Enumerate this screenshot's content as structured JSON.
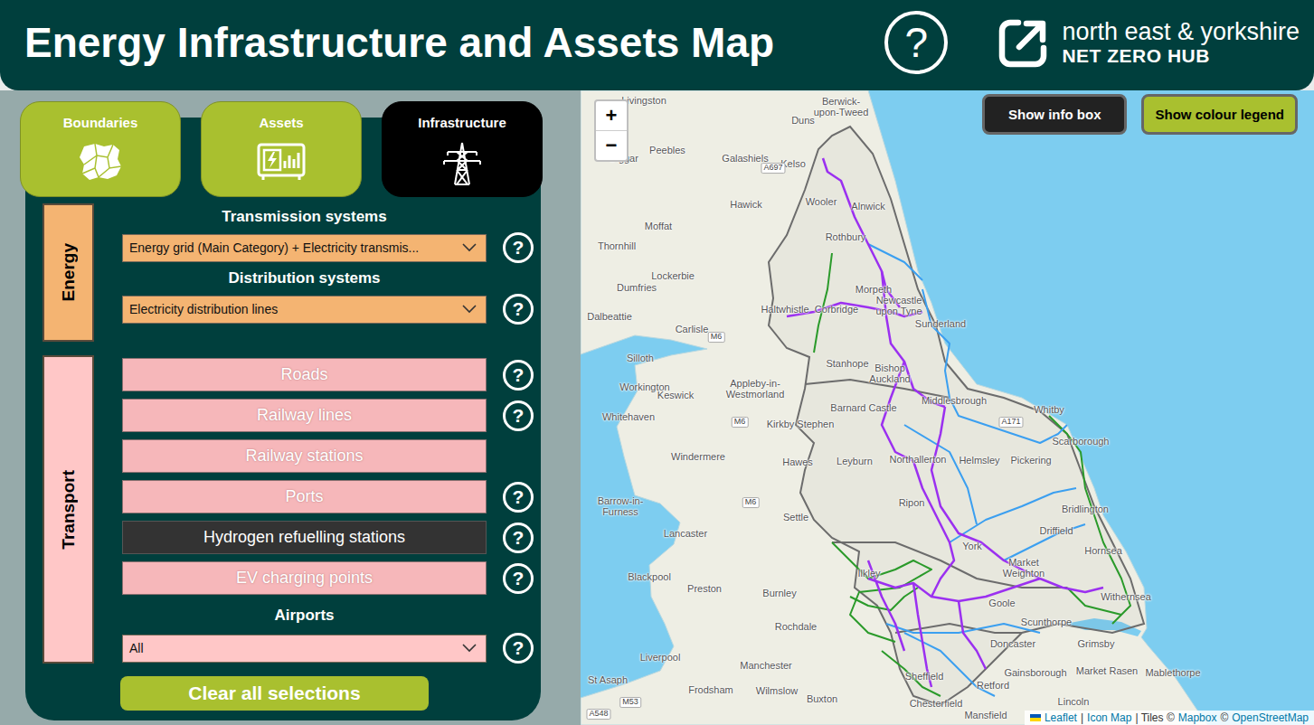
{
  "header": {
    "title": "Energy Infrastructure and Assets Map",
    "help_icon": "?",
    "logo_line1": "north east & yorkshire",
    "logo_line2": "NET ZERO HUB"
  },
  "tabs": [
    {
      "label": "Boundaries",
      "kind": "boundaries",
      "selected": false
    },
    {
      "label": "Assets",
      "kind": "assets",
      "selected": false
    },
    {
      "label": "Infrastructure",
      "kind": "infrastructure",
      "selected": true
    }
  ],
  "help_icon": "?",
  "energy": {
    "label": "Energy",
    "groups": [
      {
        "heading": "Transmission systems",
        "value": "Energy grid (Main Category) + Electricity transmis..."
      },
      {
        "heading": "Distribution systems",
        "value": "Electricity distribution lines"
      }
    ]
  },
  "transport": {
    "label": "Transport",
    "buttons": [
      {
        "label": "Roads",
        "selected": false,
        "help": true
      },
      {
        "label": "Railway lines",
        "selected": false,
        "help": true
      },
      {
        "label": "Railway stations",
        "selected": false,
        "help": false
      },
      {
        "label": "Ports",
        "selected": false,
        "help": true
      },
      {
        "label": "Hydrogen refuelling stations",
        "selected": true,
        "help": true
      },
      {
        "label": "EV charging points",
        "selected": false,
        "help": true
      }
    ],
    "airports": {
      "heading": "Airports",
      "value": "All"
    }
  },
  "clear_button": "Clear all selections",
  "map": {
    "zoom": [
      "+",
      "−"
    ],
    "buttons": [
      {
        "label": "Show info box",
        "kind": "dark"
      },
      {
        "label": "Show colour legend",
        "kind": "green"
      }
    ],
    "places": [
      {
        "name": "Livingston",
        "kind": "place"
      },
      {
        "name": "Berwick-upon-Tweed",
        "kind": "place"
      },
      {
        "name": "Duns",
        "kind": "place"
      },
      {
        "name": "Peebles",
        "kind": "place"
      },
      {
        "name": "Galashiels",
        "kind": "place"
      },
      {
        "name": "Kelso",
        "kind": "place"
      },
      {
        "name": "Biggar",
        "kind": "place"
      },
      {
        "name": "A697",
        "kind": "road"
      },
      {
        "name": "Wooler",
        "kind": "place"
      },
      {
        "name": "Hawick",
        "kind": "place"
      },
      {
        "name": "Alnwick",
        "kind": "place"
      },
      {
        "name": "Moffat",
        "kind": "place"
      },
      {
        "name": "Rothbury",
        "kind": "place"
      },
      {
        "name": "Thornhill",
        "kind": "place"
      },
      {
        "name": "Lockerbie",
        "kind": "place"
      },
      {
        "name": "Morpeth",
        "kind": "place"
      },
      {
        "name": "Dumfries",
        "kind": "place"
      },
      {
        "name": "Newcastle upon Tyne",
        "kind": "place"
      },
      {
        "name": "Sunderland",
        "kind": "place"
      },
      {
        "name": "Dalbeattie",
        "kind": "place"
      },
      {
        "name": "Haltwhistle",
        "kind": "place"
      },
      {
        "name": "Corbridge",
        "kind": "place"
      },
      {
        "name": "Carlisle",
        "kind": "place"
      },
      {
        "name": "M6",
        "kind": "road"
      },
      {
        "name": "Silloth",
        "kind": "place"
      },
      {
        "name": "Stanhope",
        "kind": "place"
      },
      {
        "name": "Bishop Auckland",
        "kind": "place"
      },
      {
        "name": "Workington",
        "kind": "place"
      },
      {
        "name": "Keswick",
        "kind": "place"
      },
      {
        "name": "Appleby-in-Westmorland",
        "kind": "place"
      },
      {
        "name": "Middlesbrough",
        "kind": "place"
      },
      {
        "name": "Barnard Castle",
        "kind": "place"
      },
      {
        "name": "Whitby",
        "kind": "place"
      },
      {
        "name": "Whitehaven",
        "kind": "place"
      },
      {
        "name": "Kirkby Stephen",
        "kind": "place"
      },
      {
        "name": "M6",
        "kind": "road"
      },
      {
        "name": "A171",
        "kind": "road"
      },
      {
        "name": "Scarborough",
        "kind": "place"
      },
      {
        "name": "Windermere",
        "kind": "place"
      },
      {
        "name": "Hawes",
        "kind": "place"
      },
      {
        "name": "Leyburn",
        "kind": "place"
      },
      {
        "name": "Northallerton",
        "kind": "place"
      },
      {
        "name": "Helmsley",
        "kind": "place"
      },
      {
        "name": "Pickering",
        "kind": "place"
      },
      {
        "name": "M6",
        "kind": "road"
      },
      {
        "name": "Ripon",
        "kind": "place"
      },
      {
        "name": "Barrow-in-Furness",
        "kind": "place"
      },
      {
        "name": "Bridlington",
        "kind": "place"
      },
      {
        "name": "Settle",
        "kind": "place"
      },
      {
        "name": "Driffield",
        "kind": "place"
      },
      {
        "name": "Lancaster",
        "kind": "place"
      },
      {
        "name": "York",
        "kind": "place"
      },
      {
        "name": "Hornsea",
        "kind": "place"
      },
      {
        "name": "Market Weighton",
        "kind": "place"
      },
      {
        "name": "Ilkley",
        "kind": "place"
      },
      {
        "name": "Blackpool",
        "kind": "place"
      },
      {
        "name": "Preston",
        "kind": "place"
      },
      {
        "name": "Burnley",
        "kind": "place"
      },
      {
        "name": "Withernsea",
        "kind": "place"
      },
      {
        "name": "Goole",
        "kind": "place"
      },
      {
        "name": "Scunthorpe",
        "kind": "place"
      },
      {
        "name": "Rochdale",
        "kind": "place"
      },
      {
        "name": "Grimsby",
        "kind": "place"
      },
      {
        "name": "Doncaster",
        "kind": "place"
      },
      {
        "name": "Liverpool",
        "kind": "place"
      },
      {
        "name": "Manchester",
        "kind": "place"
      },
      {
        "name": "Gainsborough",
        "kind": "place"
      },
      {
        "name": "Market Rasen",
        "kind": "place"
      },
      {
        "name": "Mablethorpe",
        "kind": "place"
      },
      {
        "name": "St Asaph",
        "kind": "place"
      },
      {
        "name": "Sheffield",
        "kind": "place"
      },
      {
        "name": "Retford",
        "kind": "place"
      },
      {
        "name": "Frodsham",
        "kind": "place"
      },
      {
        "name": "Wilmslow",
        "kind": "place"
      },
      {
        "name": "M53",
        "kind": "road"
      },
      {
        "name": "Buxton",
        "kind": "place"
      },
      {
        "name": "Chesterfield",
        "kind": "place"
      },
      {
        "name": "Lincoln",
        "kind": "place"
      },
      {
        "name": "A548",
        "kind": "road"
      },
      {
        "name": "Mansfield",
        "kind": "place"
      }
    ],
    "attribution": [
      {
        "text": "Leaflet",
        "link": true
      },
      {
        "text": "|",
        "link": false
      },
      {
        "text": "Icon Map",
        "link": true
      },
      {
        "text": "| Tiles ©",
        "link": false
      },
      {
        "text": "Mapbox",
        "link": true
      },
      {
        "text": "©",
        "link": false
      },
      {
        "text": "OpenStreetMap",
        "link": true
      }
    ]
  }
}
